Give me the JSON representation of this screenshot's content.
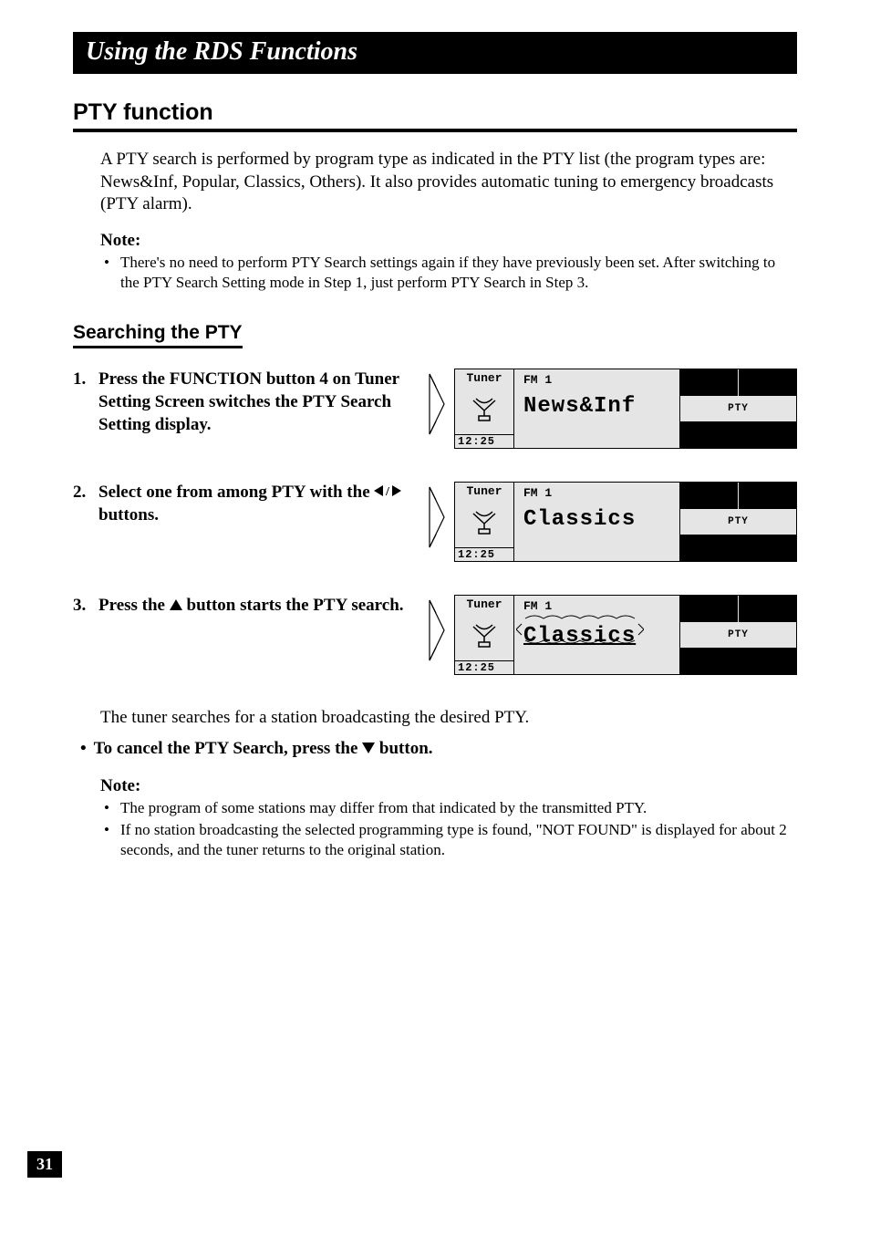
{
  "title_bar": "Using the RDS Functions",
  "section_heading": "PTY function",
  "intro_text": "A PTY search is performed by program type as indicated in the PTY list (the program types are: News&Inf, Popular, Classics, Others). It also provides automatic tuning to emergency broadcasts (PTY alarm).",
  "note1_label": "Note:",
  "note1_items": [
    "There's no need to perform PTY Search settings again if they have previously been set. After switching to the PTY Search Setting mode in Step 1, just perform PTY Search in Step 3."
  ],
  "sub_heading": "Searching the PTY",
  "steps": [
    {
      "num": "1.",
      "text": "Press the FUNCTION button 4 on Tuner Setting Screen switches the PTY Search Setting display."
    },
    {
      "num": "2.",
      "text_pre": "Select one from among PTY with the ",
      "text_post": " buttons.",
      "arrows": "◄/►"
    },
    {
      "num": "3.",
      "text_pre": "Press the ",
      "text_post": " button starts the PTY search.",
      "arrow": "▲"
    }
  ],
  "screens": [
    {
      "tuner": "Tuner",
      "band": "FM 1",
      "main": "News&Inf",
      "time": "12:25",
      "pty": "PTY"
    },
    {
      "tuner": "Tuner",
      "band": "FM 1",
      "main": "Classics",
      "time": "12:25",
      "pty": "PTY"
    },
    {
      "tuner": "Tuner",
      "band": "FM 1",
      "main": "Classics",
      "time": "12:25",
      "pty": "PTY",
      "searching": true
    }
  ],
  "post_text": "The tuner searches for a station broadcasting the desired PTY.",
  "cancel_pre": "To cancel the PTY Search, press the ",
  "cancel_post": " button.",
  "cancel_arrow": "▼",
  "note2_label": "Note:",
  "note2_items": [
    "The program of some stations may differ from that indicated by the transmitted PTY.",
    "If no station broadcasting the selected programming type is found, \"NOT FOUND\" is displayed for about 2 seconds, and the tuner returns to the original station."
  ],
  "page_number": "31"
}
